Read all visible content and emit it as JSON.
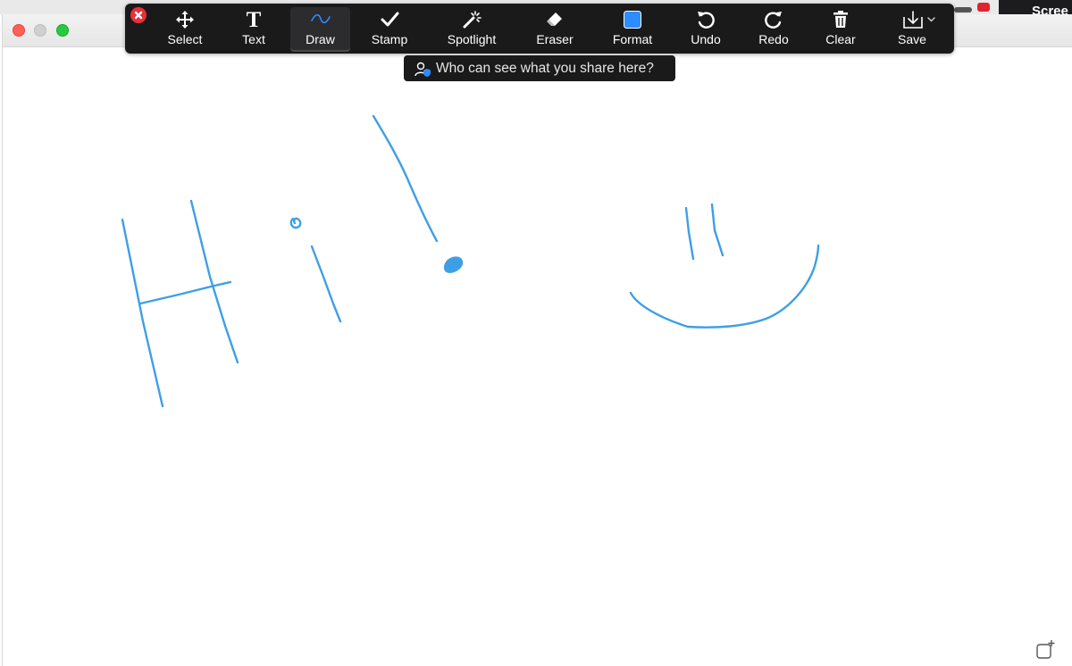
{
  "toolbar": {
    "tools": {
      "select": "Select",
      "text": "Text",
      "draw": "Draw",
      "stamp": "Stamp",
      "spotlight": "Spotlight",
      "eraser": "Eraser",
      "format": "Format",
      "undo": "Undo",
      "redo": "Redo",
      "clear": "Clear",
      "save": "Save"
    },
    "active_tool": "Draw",
    "text_icon_glyph": "T",
    "icons": {
      "close": "close-icon",
      "select": "move-arrows-icon",
      "text": "text-t-icon",
      "draw": "squiggle-icon",
      "stamp": "checkmark-icon",
      "spotlight": "magic-wand-icon",
      "eraser": "eraser-icon",
      "format": "color-square-icon",
      "undo": "undo-icon",
      "redo": "redo-icon",
      "clear": "trash-icon",
      "save": "download-icon"
    }
  },
  "share_tooltip": {
    "text": "Who can see what you share here?",
    "icon": "person-shield-icon"
  },
  "top_strip": {
    "partial_label": "Scree"
  },
  "colors": {
    "ink": "#3e9fe6",
    "toolbar_bg": "#1a1a1a",
    "format_swatch": "#2d8cff",
    "close_red": "#e8303a"
  },
  "corner_icon": "new-window-icon"
}
